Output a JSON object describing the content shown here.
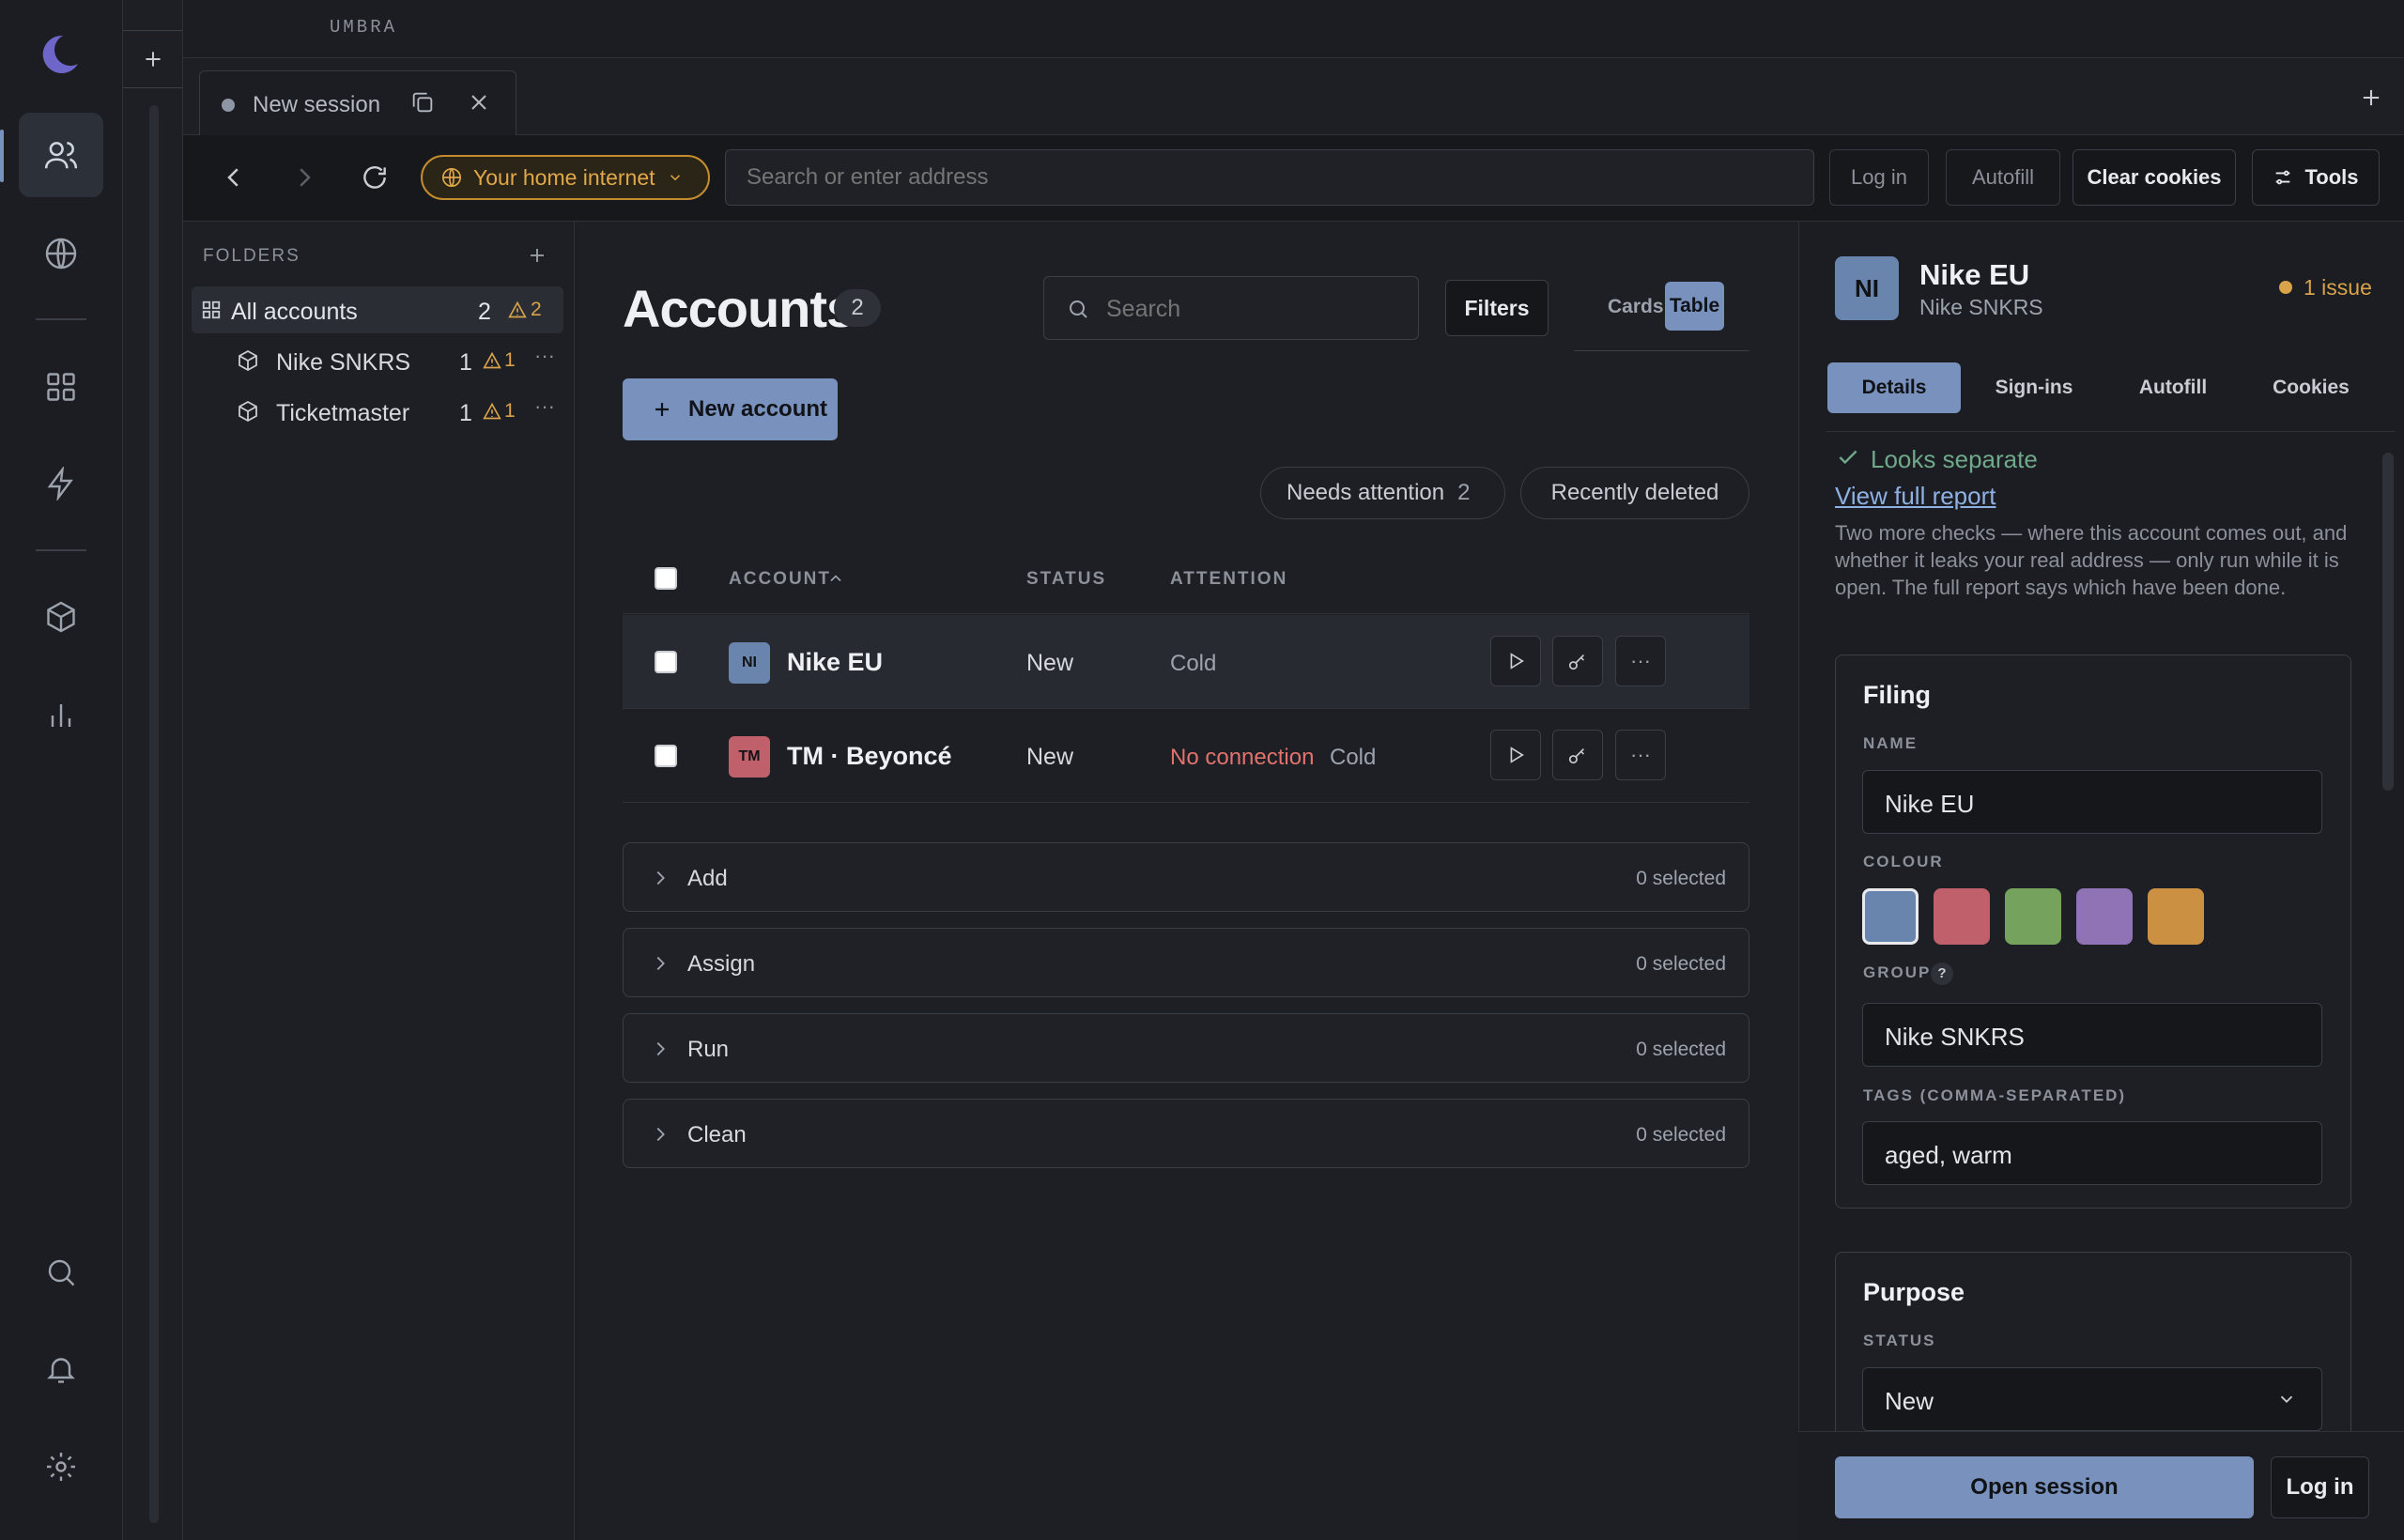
{
  "app": {
    "brand": "UMBRA"
  },
  "tab": {
    "title": "New session"
  },
  "nav": {
    "network": "Your home internet",
    "address_placeholder": "Search or enter address",
    "login": "Log in",
    "autofill": "Autofill",
    "clear_cookies": "Clear cookies",
    "tools": "Tools"
  },
  "folders": {
    "heading": "FOLDERS",
    "all": {
      "label": "All accounts",
      "count": "2",
      "warn": "2"
    },
    "items": [
      {
        "label": "Nike SNKRS",
        "count": "1",
        "warn": "1"
      },
      {
        "label": "Ticketmaster",
        "count": "1",
        "warn": "1"
      }
    ]
  },
  "main": {
    "title": "Accounts",
    "count": "2",
    "search_placeholder": "Search",
    "filters": "Filters",
    "view_cards": "Cards",
    "view_table": "Table",
    "new_account": "New account",
    "needs_attention": "Needs attention",
    "needs_attention_count": "2",
    "recently_deleted": "Recently deleted",
    "columns": {
      "account": "ACCOUNT",
      "status": "STATUS",
      "attention": "ATTENTION"
    },
    "rows": [
      {
        "initials": "NI",
        "name": "Nike EU",
        "status": "New",
        "attention_alert": "",
        "attention": "Cold",
        "color": "#6a85ad"
      },
      {
        "initials": "TM",
        "name": "TM · Beyoncé",
        "status": "New",
        "attention_alert": "No connection",
        "attention": "Cold",
        "color": "#c0606b"
      }
    ],
    "groups": [
      {
        "label": "Add",
        "selected": "0 selected"
      },
      {
        "label": "Assign",
        "selected": "0 selected"
      },
      {
        "label": "Run",
        "selected": "0 selected"
      },
      {
        "label": "Clean",
        "selected": "0 selected"
      }
    ]
  },
  "detail": {
    "initials": "NI",
    "name": "Nike EU",
    "group_name": "Nike SNKRS",
    "issue": "1 issue",
    "tabs": [
      "Details",
      "Sign-ins",
      "Autofill",
      "Cookies"
    ],
    "looks": "Looks separate",
    "report_link": "View full report",
    "note": "Two more checks — where this account comes out, and whether it leaks your real address — only run while it is open. The full report says which have been done.",
    "filing": {
      "title": "Filing",
      "name_label": "NAME",
      "name_value": "Nike EU",
      "colour_label": "COLOUR",
      "colours": [
        "#6a85ad",
        "#c0606b",
        "#75a35e",
        "#8f73b5",
        "#cc9042"
      ],
      "group_label": "GROUP",
      "group_help": "?",
      "group_value": "Nike SNKRS",
      "tags_label": "TAGS (COMMA-SEPARATED)",
      "tags_value": "aged, warm"
    },
    "purpose": {
      "title": "Purpose",
      "status_label": "STATUS",
      "status_value": "New"
    },
    "open_session": "Open session",
    "login": "Log in"
  },
  "colors": {
    "accent": "#7892bd",
    "warn": "#d8a34a",
    "alert": "#e0736b",
    "success": "#6fa98a"
  }
}
